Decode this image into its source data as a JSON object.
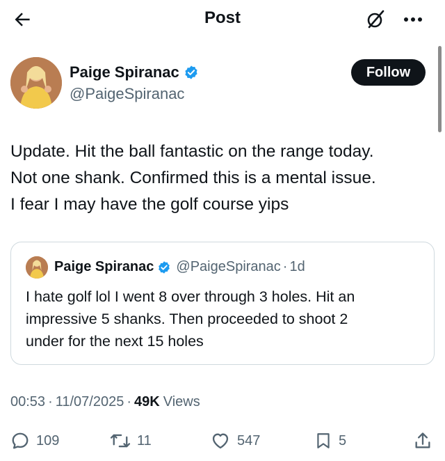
{
  "header": {
    "title": "Post",
    "back_icon": "arrow-left-icon",
    "grok_icon": "grok-icon",
    "more_icon": "more-horizontal-icon"
  },
  "author": {
    "name": "Paige Spiranac",
    "handle": "@PaigeSpiranac",
    "verified": true,
    "follow_label": "Follow"
  },
  "tweet": {
    "lines": [
      "Update. Hit the ball fantastic on the range today.",
      "Not one shank. Confirmed this is a mental issue.",
      "I fear I may have the golf course yips"
    ]
  },
  "quoted": {
    "name": "Paige Spiranac",
    "handle": "@PaigeSpiranac",
    "separator": "·",
    "time": "1d",
    "lines": [
      "I hate golf lol I went 8 over through 3 holes. Hit an",
      "impressive 5 shanks. Then proceeded to shoot 2",
      "under for the next 15 holes"
    ]
  },
  "meta": {
    "time": "00:53",
    "separator": "·",
    "date": "11/07/2025",
    "views_count": "49K",
    "views_label": "Views"
  },
  "actions": {
    "replies": "109",
    "reposts": "11",
    "likes": "547",
    "bookmarks": "5"
  },
  "colors": {
    "text": "#0f1419",
    "secondary": "#536471",
    "verified": "#1d9bf0",
    "border": "#cfd9de",
    "follow_bg": "#0f1419"
  }
}
